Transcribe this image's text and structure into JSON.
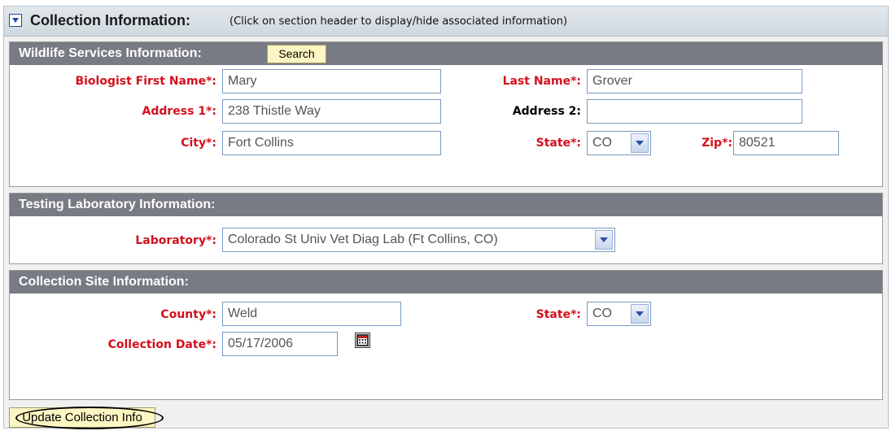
{
  "collection_info": {
    "title": "Collection Information:",
    "hint": "(Click on section header to display/hide associated information)"
  },
  "wildlife_services": {
    "title": "Wildlife Services Information:",
    "search_label": "Search",
    "first_name_label": "Biologist First Name*:",
    "first_name_value": "Mary",
    "last_name_label": "Last Name*:",
    "last_name_value": "Grover",
    "address1_label": "Address 1*:",
    "address1_value": "238 Thistle Way",
    "address2_label": "Address 2:",
    "address2_value": "",
    "city_label": "City*:",
    "city_value": "Fort Collins",
    "state_label": "State*:",
    "state_value": "CO",
    "zip_label": "Zip*:",
    "zip_value": "80521"
  },
  "testing_lab": {
    "title": "Testing Laboratory Information:",
    "lab_label": "Laboratory*:",
    "lab_value": "Colorado St Univ Vet Diag Lab  (Ft Collins, CO)"
  },
  "collection_site": {
    "title": "Collection Site Information:",
    "county_label": "County*:",
    "county_value": "Weld",
    "state_label": "State*:",
    "state_value": "CO",
    "date_label": "Collection Date*:",
    "date_value": "05/17/2006"
  },
  "actions": {
    "update_label": "Update Collection Info"
  },
  "icons": {
    "toggle": "chevron-down-icon",
    "dropdown": "dropdown-arrow-icon",
    "calendar": "calendar-icon"
  },
  "colors": {
    "required_label": "#d3101d",
    "section_header": "#787b83",
    "button_bg": "#fdf6c3",
    "field_border": "#7a9ac2"
  }
}
